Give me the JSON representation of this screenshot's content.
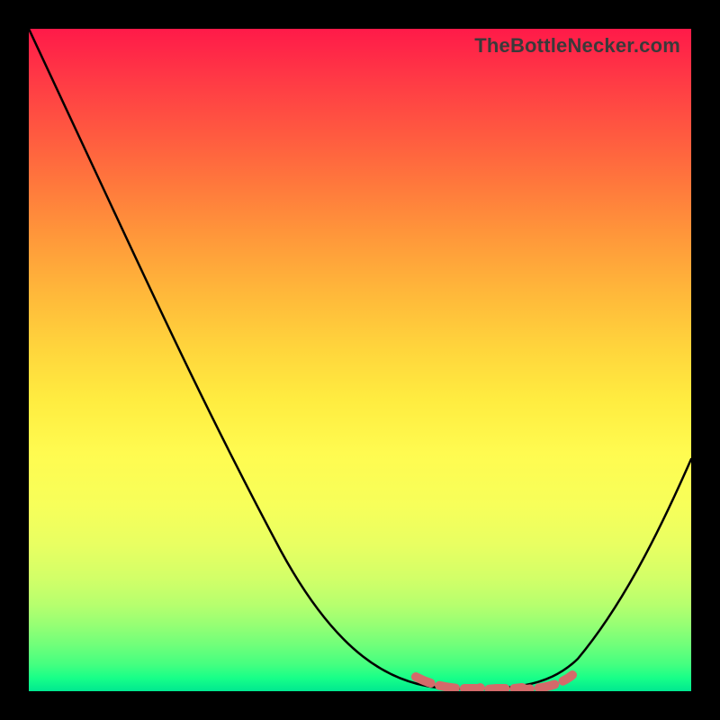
{
  "watermark": "TheBottleNecker.com",
  "colors": {
    "background": "#000000",
    "curve": "#000000",
    "marker": "#d46a6a",
    "gradient_top": "#ff1a49",
    "gradient_bottom": "#00e890"
  },
  "chart_data": {
    "type": "line",
    "title": "",
    "xlabel": "",
    "ylabel": "",
    "xlim": [
      0,
      100
    ],
    "ylim": [
      0,
      100
    ],
    "grid": false,
    "legend_position": "none",
    "series": [
      {
        "name": "bottleneck-curve",
        "x": [
          0,
          5,
          10,
          15,
          20,
          25,
          30,
          35,
          40,
          45,
          50,
          55,
          60,
          64,
          68,
          72,
          76,
          80,
          84,
          88,
          92,
          96,
          100
        ],
        "values": [
          100,
          92,
          84,
          76,
          68,
          60,
          52,
          44,
          36,
          28,
          20,
          13,
          7,
          3,
          1,
          0.5,
          1,
          3,
          8,
          15,
          23,
          30,
          35
        ]
      },
      {
        "name": "optimal-region",
        "x": [
          58,
          62,
          66,
          70,
          74,
          78,
          82
        ],
        "values": [
          2,
          1,
          0.5,
          0.5,
          0.5,
          1,
          2.5
        ]
      }
    ],
    "annotations": [
      {
        "text": "TheBottleNecker.com",
        "position": "top-right"
      }
    ],
    "background_gradient": {
      "direction": "vertical",
      "stops": [
        {
          "pos": 0.0,
          "color": "#ff1a49"
        },
        {
          "pos": 0.5,
          "color": "#ffec40"
        },
        {
          "pos": 0.8,
          "color": "#e8ff62"
        },
        {
          "pos": 1.0,
          "color": "#00e890"
        }
      ]
    }
  }
}
